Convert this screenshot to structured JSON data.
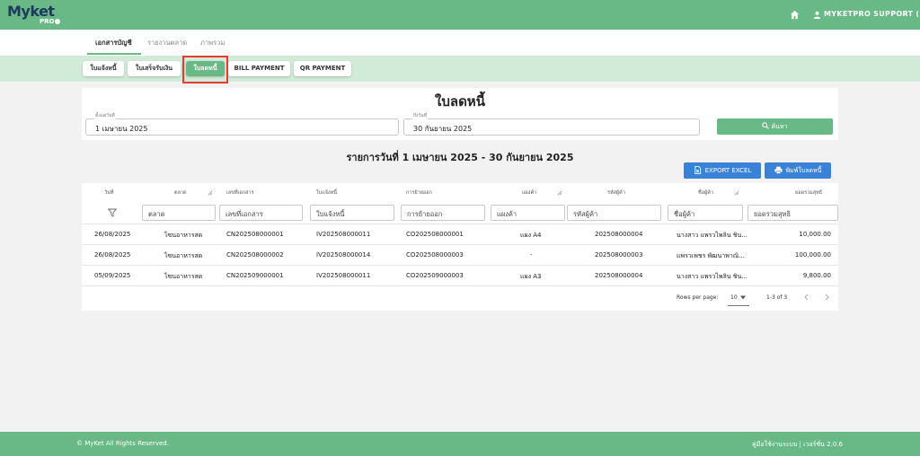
{
  "app": {
    "logo": "Myket",
    "logo_sub": "PRO"
  },
  "header": {
    "user_name": "MYKETPRO SUPPORT (P)"
  },
  "nav": {
    "tabs": [
      {
        "label": "เอกสารบัญชี"
      },
      {
        "label": "รายงานตลาด"
      },
      {
        "label": "ภาพรวม"
      }
    ]
  },
  "subtabs": [
    {
      "label": "ใบแจ้งหนี้"
    },
    {
      "label": "ใบเสร็จรับเงิน"
    },
    {
      "label": "ใบลดหนี้"
    },
    {
      "label": "BILL PAYMENT"
    },
    {
      "label": "QR PAYMENT"
    }
  ],
  "filters": {
    "start_label": "ตั้งแต่วันที่",
    "start_value": "1 เมษายน 2025",
    "end_label": "ถึงวันที่",
    "end_value": "30 กันยายน 2025",
    "search_label": "ค้นหา"
  },
  "page": {
    "title": "ใบลดหนี้",
    "range_title": "รายการวันที่ 1 เมษายน 2025 - 30 กันยายน 2025"
  },
  "actions": {
    "export_label": "EXPORT EXCEL",
    "print_label": "พิมพ์ใบลดหนี้"
  },
  "table": {
    "columns": [
      "วันที่",
      "ตลาด",
      "เลขที่เอกสาร",
      "ใบแจ้งหนี้",
      "การย้ายออก",
      "แผงค้า",
      "รหัสผู้ค้า",
      "ชื่อผู้ค้า",
      "ยอดรวมสุทธิ"
    ],
    "filters": [
      "ตลาด",
      "เลขที่เอกสาร",
      "ใบแจ้งหนี้",
      "การย้ายออก",
      "แผงค้า",
      "รหัสผู้ค้า",
      "ชื่อผู้ค้า",
      "ยอดรวมสุทธิ"
    ],
    "rows": [
      [
        "26/08/2025",
        "ไซนอาหารสด",
        "CN202508000001",
        "IV202508000011",
        "CO202508000001",
        "แผง A4",
        "202508000004",
        "นางสาว แพรวไพลิน ชิน...",
        "10,000.00"
      ],
      [
        "26/08/2025",
        "ไซนอาหารสด",
        "CN202508000002",
        "IV202508000014",
        "CO202508000003",
        "-",
        "202508000003",
        "แพรวเพชร พัฒนาพาณิ...",
        "100,000.00"
      ],
      [
        "05/09/2025",
        "ไซนอาหารสด",
        "CN202509000001",
        "IV202508000011",
        "CO202509000003",
        "แผง A3",
        "202508000004",
        "นางสาว แพรวไพลิน ชิน...",
        "9,800.00"
      ]
    ],
    "pager": {
      "rows_label": "Rows per page:",
      "rows_value": "10",
      "range": "1-3 of 3"
    }
  },
  "footer": {
    "copyright": "© MyKet All Rights Reserved.",
    "version": "คู่มือใช้งานระบบ | เวอร์ชั่น 2.0.6"
  },
  "colors": {
    "brand": "#68b985",
    "accent": "#3a82d8",
    "highlight": "#e53b2f"
  }
}
